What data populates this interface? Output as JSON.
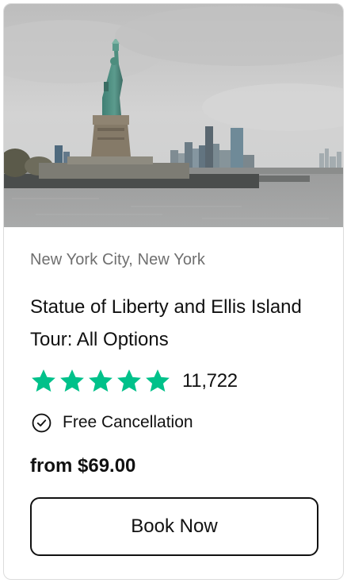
{
  "card": {
    "location": "New York City, New York",
    "title": "Statue of Liberty and Ellis Island Tour: All Options",
    "rating": {
      "stars": 5,
      "review_count": "11,722",
      "star_color": "#00c18a"
    },
    "cancellation": {
      "icon": "check-circle-icon",
      "label": "Free Cancellation"
    },
    "price": "from $69.00",
    "book_button_label": "Book Now"
  }
}
